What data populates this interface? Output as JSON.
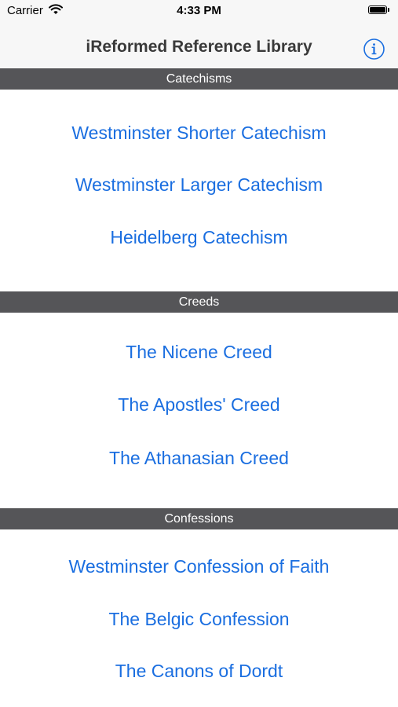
{
  "status_bar": {
    "carrier": "Carrier",
    "time": "4:33 PM"
  },
  "nav": {
    "title": "iReformed Reference Library",
    "info_icon": "info-circle-icon"
  },
  "sections": [
    {
      "header": "Catechisms",
      "items": [
        "Westminster Shorter Catechism",
        "Westminster Larger Catechism",
        "Heidelberg Catechism"
      ]
    },
    {
      "header": "Creeds",
      "items": [
        "The Nicene Creed",
        "The Apostles' Creed",
        "The Athanasian Creed"
      ]
    },
    {
      "header": "Confessions",
      "items": [
        "Westminster Confession of Faith",
        "The Belgic Confession",
        "The Canons of Dordt"
      ]
    }
  ],
  "colors": {
    "link": "#1a6ee0",
    "section_header_bg": "#555558",
    "nav_bg": "#f7f7f7"
  }
}
